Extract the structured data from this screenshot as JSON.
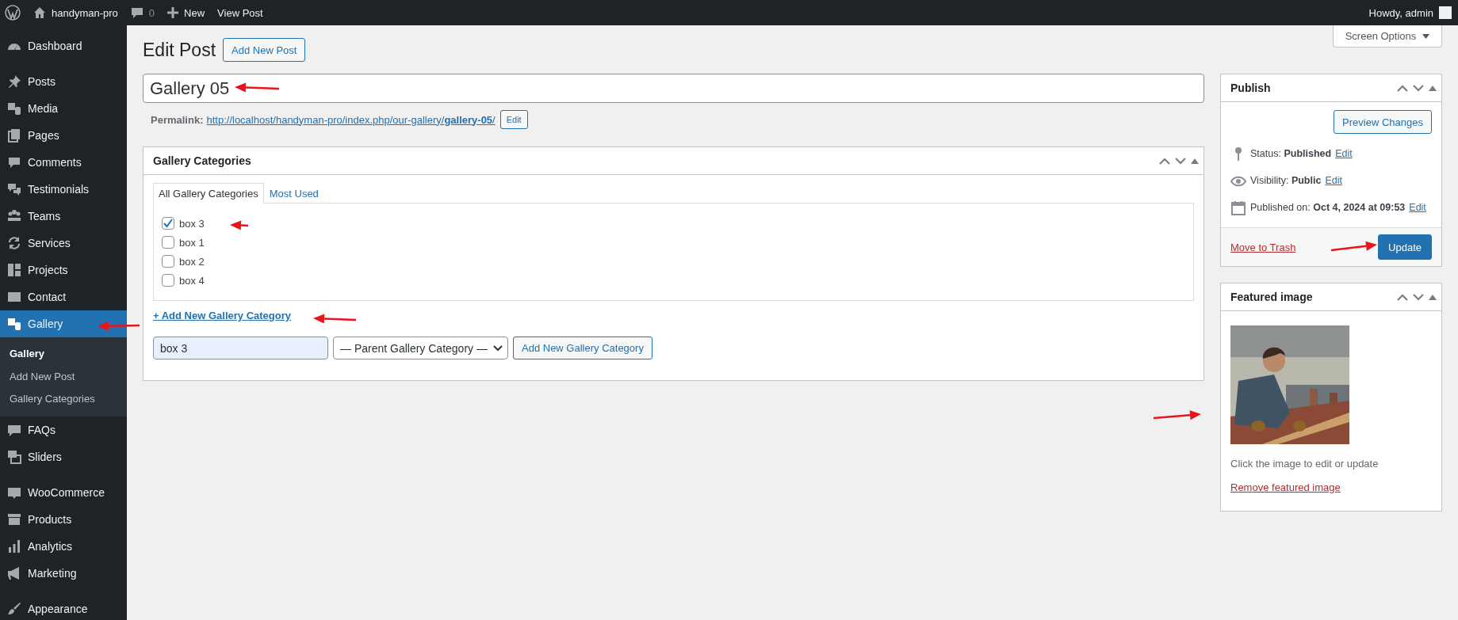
{
  "admin_bar": {
    "site": "handyman-pro",
    "comments": "0",
    "new": "New",
    "view": "View Post",
    "greeting": "Howdy, admin"
  },
  "sidebar": {
    "groups": [
      {
        "items": [
          {
            "label": "Dashboard",
            "selected": false
          }
        ]
      },
      {
        "items": [
          {
            "label": "Posts",
            "selected": false
          },
          {
            "label": "Media",
            "selected": false
          },
          {
            "label": "Pages",
            "selected": false
          },
          {
            "label": "Comments",
            "selected": false
          },
          {
            "label": "Testimonials",
            "selected": false
          },
          {
            "label": "Teams",
            "selected": false
          },
          {
            "label": "Services",
            "selected": false
          },
          {
            "label": "Projects",
            "selected": false
          },
          {
            "label": "Contact",
            "selected": false
          },
          {
            "label": "Gallery",
            "selected": true,
            "children": [
              {
                "label": "Gallery",
                "selected": true
              },
              {
                "label": "Add New Post",
                "selected": false
              },
              {
                "label": "Gallery Categories",
                "selected": false
              }
            ]
          },
          {
            "label": "FAQs",
            "selected": false
          },
          {
            "label": "Sliders",
            "selected": false
          }
        ]
      },
      {
        "items": [
          {
            "label": "WooCommerce",
            "selected": false
          },
          {
            "label": "Products",
            "selected": false
          },
          {
            "label": "Analytics",
            "selected": false
          },
          {
            "label": "Marketing",
            "selected": false
          }
        ]
      },
      {
        "items": [
          {
            "label": "Appearance",
            "selected": false
          }
        ]
      }
    ]
  },
  "screen_options": "Screen Options",
  "heading": "Edit Post",
  "add_new": "Add New Post",
  "title_field": {
    "value": "Gallery 05"
  },
  "permalink": {
    "label": "Permalink:",
    "url": "http://localhost/handyman-pro/index.php/our-gallery/**gallery-05**/",
    "edit": "Edit"
  },
  "categories_box": {
    "title": "Gallery Categories",
    "tabs": [
      {
        "label": "All Gallery Categories",
        "selected": true
      },
      {
        "label": "Most Used",
        "selected": false
      }
    ],
    "categories": [
      {
        "label": "box 3",
        "checked": true
      },
      {
        "label": "box 1",
        "checked": false
      },
      {
        "label": "box 2",
        "checked": false
      },
      {
        "label": "box 4",
        "checked": false
      }
    ],
    "add_link": "+ Add New Gallery Category",
    "name_field": {
      "value": "box 3"
    },
    "parent_select": {
      "value": "— Parent Gallery Category —"
    },
    "add_button": "Add New Gallery Category"
  },
  "publish_box": {
    "title": "Publish",
    "preview": "Preview Changes",
    "rows": [
      {
        "label": "Status:",
        "value": "Published",
        "link": "Edit"
      },
      {
        "label": "Visibility:",
        "value": "Public",
        "link": "Edit"
      },
      {
        "label": "Published on:",
        "value": "Oct 4, 2024 at 09:53",
        "link": "Edit"
      }
    ],
    "trash": "Move to Trash",
    "update": "Update"
  },
  "featured_box": {
    "title": "Featured image",
    "hint": "Click the image to edit or update",
    "remove": "Remove featured image"
  }
}
